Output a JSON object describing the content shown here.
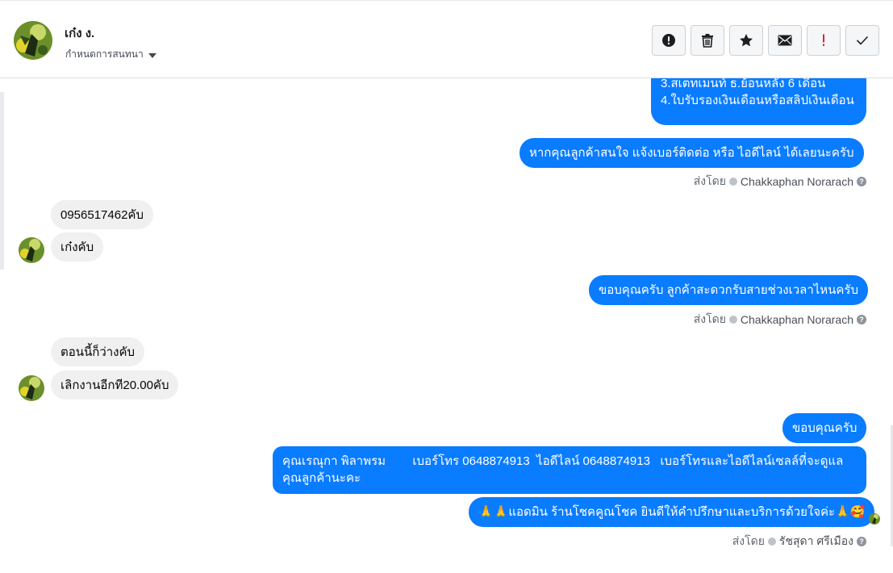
{
  "header": {
    "contact_name": "เก๋ง ง.",
    "assign_label": "กำหนดการสนทนา"
  },
  "toolbar": {
    "icons": [
      "alert-circle-icon",
      "trash-icon",
      "star-icon",
      "mail-icon",
      "exclamation-icon",
      "check-icon"
    ]
  },
  "messages": {
    "m1_line1": "3.สเตทเมนท์ ธ.ย้อนหลัง 6 เดือน",
    "m1_line2": "4.ใบรับรองเงินเดือนหรือสลิปเงินเดือน",
    "m2": "หากคุณลูกค้าสนใจ แจ้งเบอร์ติดต่อ หรือ ไอดีไลน์ ได้เลยนะครับ",
    "m3": "0956517462คับ",
    "m4": "เก๋งคับ",
    "m5": "ขอบคุณครับ ลูกค้าสะดวกรับสายช่วงเวลาไหนครับ",
    "m6": "ตอนนี้ก็ว่างคับ",
    "m7": "เลิกงานอีกที20.00คับ",
    "m8": "ขอบคุณครับ",
    "m9_line1": "คุณเรณุกา พิลาพรม        เบอร์โทร 0648874913  ไอดีไลน์ 0648874913   เบอร์โทรและไอดีไลน์เซลล์ที่จะดูแล",
    "m9_line2": "คุณลูกค้านะคะ",
    "m10": "🙏🙏แอดมิน ร้านโชคคูณโชค ยินดีให้คำปรึกษาและบริการด้วยใจค่ะ🙏🥰"
  },
  "sent_by": {
    "prefix": "ส่งโดย",
    "agent1": "Chakkaphan Norarach",
    "agent2": "Chakkaphan Norarach",
    "agent3": "รัชสุดา ศรีเมือง"
  },
  "colors": {
    "outgoing": "#0a7cff",
    "incoming": "#f0f0f0"
  }
}
